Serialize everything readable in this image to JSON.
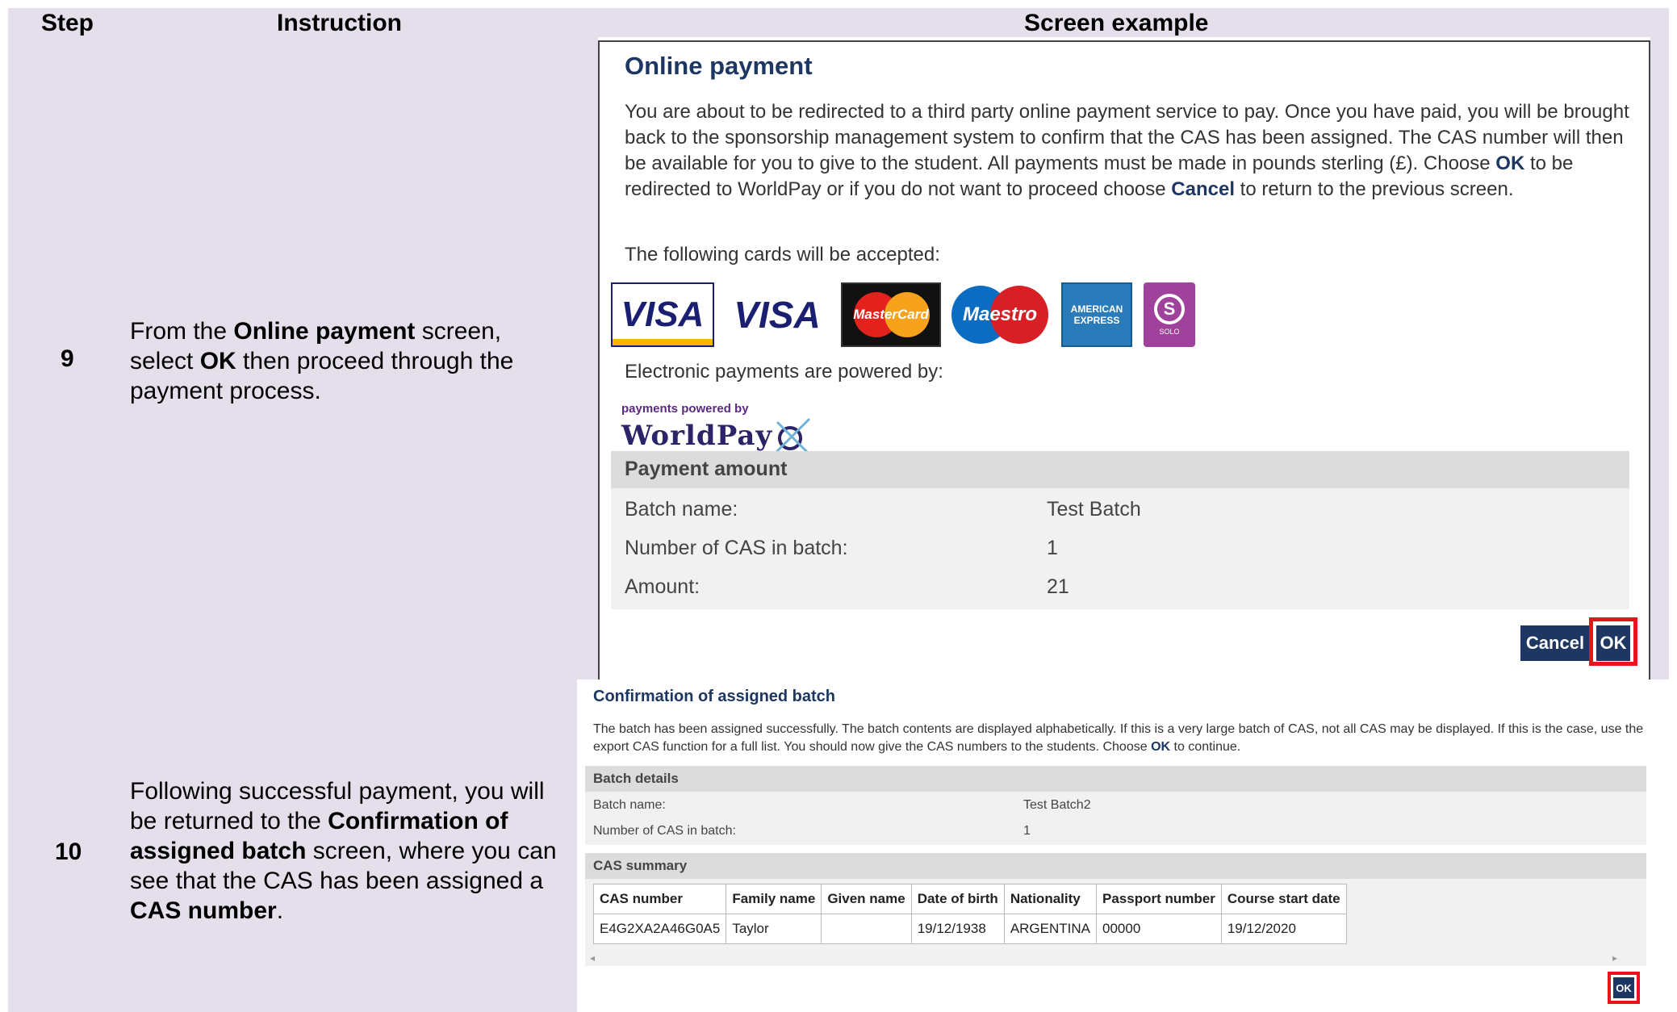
{
  "table_headers": {
    "step": "Step",
    "instruction": "Instruction",
    "screen": "Screen example"
  },
  "rows": [
    {
      "step": "9",
      "instruction_parts": [
        "From the ",
        "Online payment",
        " screen, select ",
        "OK",
        " then proceed through the payment process."
      ]
    },
    {
      "step": "10",
      "instruction_parts": [
        "Following successful payment, you will be returned to the ",
        "Confirmation of assigned batch",
        " screen, where you can see that the CAS has been assigned a ",
        "CAS number",
        "."
      ]
    }
  ],
  "online_payment": {
    "title": "Online payment",
    "text_parts": [
      "You are about to be redirected to a third party online payment service to pay. Once you have paid, you will be brought back to the sponsorship management system to confirm that the CAS has been assigned. The CAS number will then be available for you to give to the student. All payments must be made in pounds sterling (£). Choose ",
      "OK",
      " to be redirected to WorldPay or if you do not want to proceed choose ",
      "Cancel",
      " to return to the previous screen."
    ],
    "cards_label": "The following cards will be accepted:",
    "cards": [
      {
        "name": "visa-electron-card-icon",
        "text": "VISA",
        "sub": ""
      },
      {
        "name": "visa-card-icon",
        "text": "VISA",
        "sub": ""
      },
      {
        "name": "mastercard-icon",
        "text": "MasterCard",
        "sub": ""
      },
      {
        "name": "maestro-icon",
        "text": "Maestro",
        "sub": ""
      },
      {
        "name": "american-express-icon",
        "text": "AMERICAN",
        "sub": "EXPRESS"
      },
      {
        "name": "solo-icon",
        "text": "S",
        "sub": "SOLO"
      }
    ],
    "powered_label": "Electronic payments are powered by:",
    "worldpay_small": "payments powered by",
    "worldpay_big": "WorldPay",
    "payment_amount": {
      "heading": "Payment amount",
      "rows": [
        {
          "label": "Batch name:",
          "value": "Test Batch"
        },
        {
          "label": "Number of CAS in batch:",
          "value": "1"
        },
        {
          "label": "Amount:",
          "value": "21"
        }
      ]
    },
    "cancel_label": "Cancel",
    "ok_label": "OK"
  },
  "confirmation": {
    "title": "Confirmation of assigned batch",
    "text_parts": [
      "The batch has been assigned successfully. The batch contents are displayed alphabetically. If this is a very large batch of CAS, not all CAS may be displayed. If this is the case, use the export CAS function for a full list. You should now give the CAS numbers to the students. Choose ",
      "OK",
      " to continue."
    ],
    "batch_details": {
      "heading": "Batch details",
      "rows": [
        {
          "label": "Batch name:",
          "value": "Test Batch2"
        },
        {
          "label": "Number of CAS in batch:",
          "value": "1"
        }
      ]
    },
    "cas_summary": {
      "heading": "CAS summary",
      "columns": [
        "CAS number",
        "Family name",
        "Given name",
        "Date of birth",
        "Nationality",
        "Passport number",
        "Course start date"
      ],
      "rows": [
        [
          "E4G2XA2A46G0A5",
          "Taylor",
          "",
          "19/12/1938",
          "ARGENTINA",
          "00000",
          "19/12/2020"
        ]
      ]
    },
    "scroll_left": "◂",
    "scroll_right": "▸",
    "ok_label": "OK"
  }
}
